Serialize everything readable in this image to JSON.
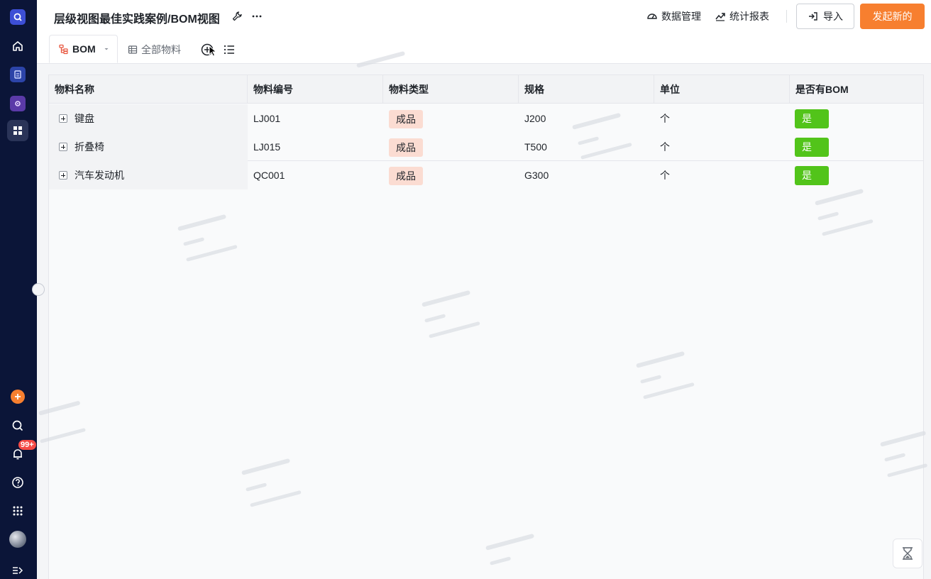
{
  "header": {
    "title": "层级视图最佳实践案例/BOM视图",
    "data_manage": "数据管理",
    "stats_report": "统计报表",
    "import_label": "导入",
    "launch_label": "发起新的"
  },
  "tabs": {
    "bom_label": "BOM",
    "all_label": "全部物料"
  },
  "sidebar": {
    "notification_badge": "99+"
  },
  "table": {
    "columns": [
      "物料名称",
      "物料编号",
      "物料类型",
      "规格",
      "单位",
      "是否有BOM"
    ],
    "rows": [
      {
        "name": "键盘",
        "code": "LJ001",
        "type": "成品",
        "spec": "J200",
        "unit": "个",
        "has_bom": "是"
      },
      {
        "name": "折叠椅",
        "code": "LJ015",
        "type": "成品",
        "spec": "T500",
        "unit": "个",
        "has_bom": "是"
      },
      {
        "name": "汽车发动机",
        "code": "QC001",
        "type": "成品",
        "spec": "G300",
        "unit": "个",
        "has_bom": "是"
      }
    ]
  },
  "colors": {
    "sidebar_bg": "#0b1538",
    "accent_orange": "#f77f2f",
    "yes_green": "#52c41a",
    "type_tag_bg": "#fbdcd2"
  },
  "icons": {
    "wrench": "wrench-icon",
    "more": "more-icon",
    "dashboard": "dashboard-icon",
    "trend": "trend-icon",
    "import": "import-icon",
    "bom_tree": "bom-tree-icon",
    "table": "table-icon",
    "add": "add-view-icon",
    "list": "list-icon",
    "hourglass": "hourglass-icon"
  }
}
